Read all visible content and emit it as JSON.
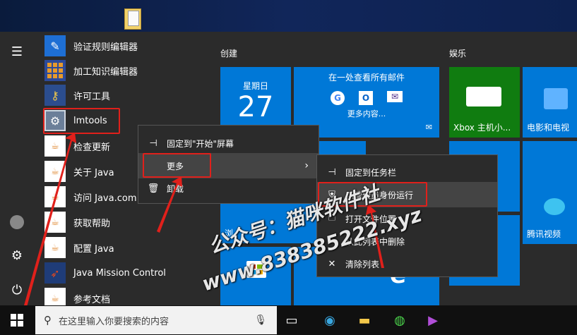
{
  "applist": [
    {
      "label": "验证规则编辑器",
      "icon": "pen-icon"
    },
    {
      "label": "加工知识编辑器",
      "icon": "grid-icon"
    },
    {
      "label": "许可工具",
      "icon": "key-icon"
    },
    {
      "label": "lmtools",
      "icon": "lmtools-icon"
    },
    {
      "label": "检查更新",
      "icon": "java-icon"
    },
    {
      "label": "关于 Java",
      "icon": "java-icon"
    },
    {
      "label": "访问 Java.com",
      "icon": "java-icon"
    },
    {
      "label": "获取帮助",
      "icon": "java-icon"
    },
    {
      "label": "配置 Java",
      "icon": "java-icon"
    },
    {
      "label": "Java Mission Control",
      "icon": "jmc-icon"
    },
    {
      "label": "参考文档",
      "icon": "java-icon"
    }
  ],
  "tiles": {
    "group_create": "创建",
    "group_entertainment": "娱乐",
    "calendar_weekday": "星期日",
    "calendar_day": "27",
    "mail_title": "在一处查看所有邮件",
    "mail_more": "更多内容...",
    "xbox_label": "Xbox 主机小...",
    "movies_label": "电影和电视",
    "tencent_label": "腾讯视频",
    "partial_label": "浏"
  },
  "context_menu_1": {
    "pin_start": "固定到\"开始\"屏幕",
    "more": "更多",
    "uninstall": "卸载"
  },
  "context_menu_2": {
    "pin_taskbar": "固定到任务栏",
    "run_admin": "以管理员身份运行",
    "open_location": "打开文件位置",
    "remove_list": "从此列表中删除",
    "clear_list": "清除列表"
  },
  "taskbar": {
    "search_placeholder": "在这里输入你要搜索的内容"
  },
  "watermark": {
    "line1": "公众号：猫咪软件社",
    "line2": "www.838385222.xyz"
  },
  "colors": {
    "accent": "#0078d7",
    "highlight_red": "#e0201b",
    "menu_bg": "#2b2b2b"
  }
}
